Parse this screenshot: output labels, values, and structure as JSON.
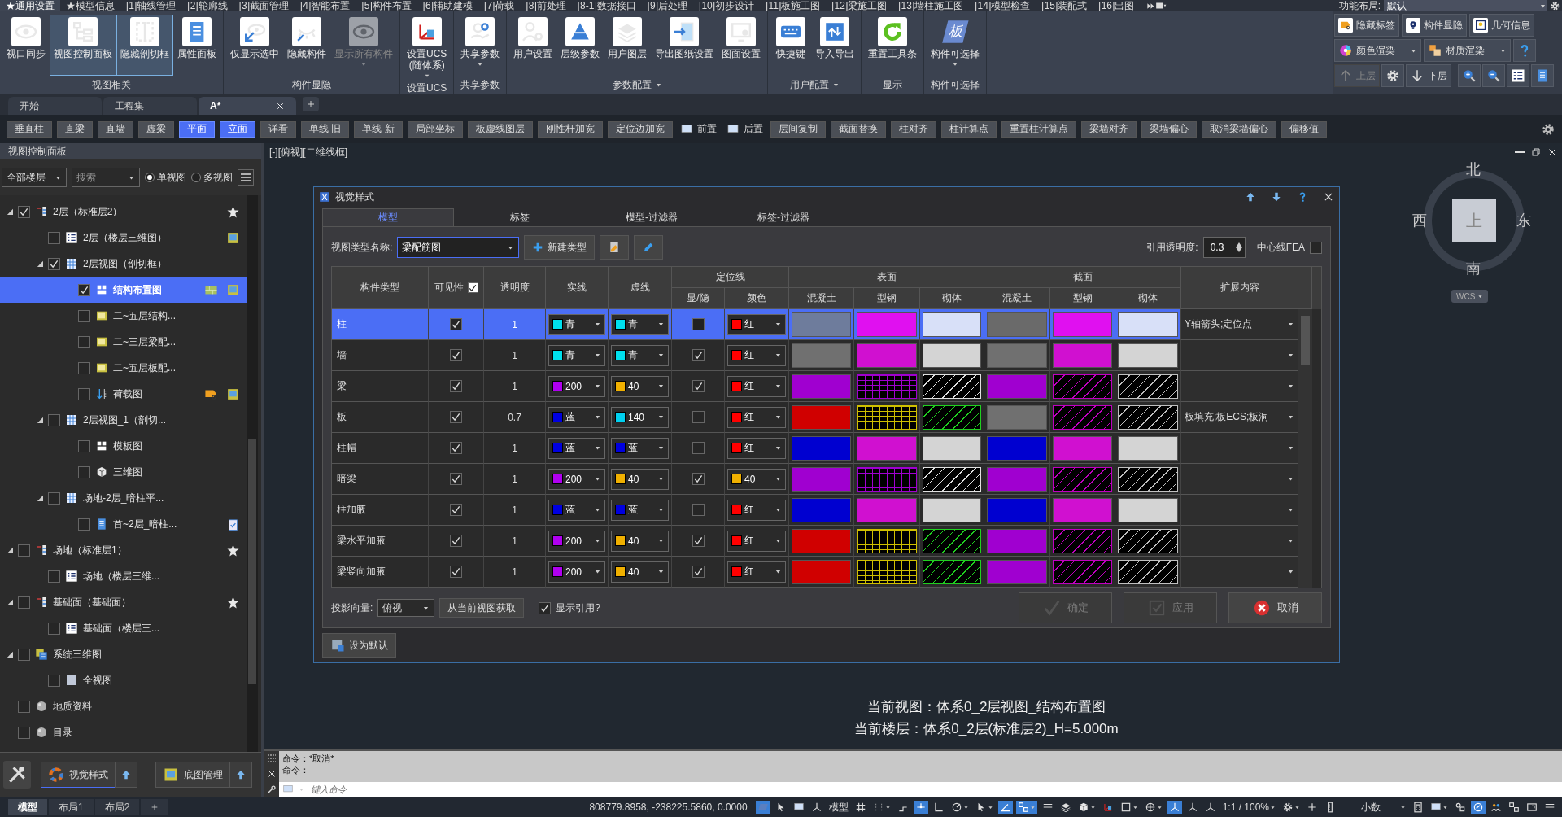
{
  "menu_tabs": [
    {
      "label": "★通用设置",
      "selected": true
    },
    {
      "label": "★模型信息",
      "selected": false
    },
    {
      "label": "[1]轴线管理",
      "selected": false
    },
    {
      "label": "[2]轮廓线",
      "selected": false
    },
    {
      "label": "[3]截面管理",
      "selected": false
    },
    {
      "label": "[4]智能布置",
      "selected": false
    },
    {
      "label": "[5]构件布置",
      "selected": false
    },
    {
      "label": "[6]辅助建模",
      "selected": false
    },
    {
      "label": "[7]荷载",
      "selected": false
    },
    {
      "label": "[8]前处理",
      "selected": false
    },
    {
      "label": "[8-1]数据接口",
      "selected": false
    },
    {
      "label": "[9]后处理",
      "selected": false
    },
    {
      "label": "[10]初步设计",
      "selected": false
    },
    {
      "label": "[11]板施工图",
      "selected": false
    },
    {
      "label": "[12]梁施工图",
      "selected": false
    },
    {
      "label": "[13]墙柱施工图",
      "selected": false
    },
    {
      "label": "[14]模型检查",
      "selected": false
    },
    {
      "label": "[15]装配式",
      "selected": false
    },
    {
      "label": "[16]出图",
      "selected": false
    }
  ],
  "layout_selector": {
    "label": "功能布局:",
    "value": "默认"
  },
  "ribbon": {
    "groups": [
      {
        "title": "视图相关",
        "menu": false,
        "buttons": [
          {
            "label": "视口同步",
            "selected": false,
            "disabled": false,
            "dropdown": false
          },
          {
            "label": "视图控制面板",
            "selected": true,
            "disabled": false,
            "dropdown": false
          },
          {
            "label": "隐藏剖切框",
            "selected": true,
            "disabled": false,
            "dropdown": false
          },
          {
            "label": "属性面板",
            "selected": false,
            "disabled": false,
            "dropdown": false
          }
        ]
      },
      {
        "title": "构件显隐",
        "menu": false,
        "buttons": [
          {
            "label": "仅显示选中",
            "selected": false,
            "disabled": false,
            "dropdown": false
          },
          {
            "label": "隐藏构件",
            "selected": false,
            "disabled": false,
            "dropdown": false
          },
          {
            "label": "显示所有构件",
            "selected": false,
            "disabled": true,
            "dropdown": true
          }
        ]
      },
      {
        "title": "设置UCS",
        "menu": false,
        "buttons": [
          {
            "label": "设置UCS\n(随体系)",
            "selected": false,
            "disabled": false,
            "dropdown": true
          }
        ]
      },
      {
        "title": "共享参数",
        "menu": false,
        "buttons": [
          {
            "label": "共享参数",
            "selected": false,
            "disabled": false,
            "dropdown": true
          }
        ]
      },
      {
        "title": "参数配置",
        "menu": true,
        "buttons": [
          {
            "label": "用户设置",
            "selected": false,
            "disabled": false,
            "dropdown": false
          },
          {
            "label": "层级参数",
            "selected": false,
            "disabled": false,
            "dropdown": false
          },
          {
            "label": "用户图层",
            "selected": false,
            "disabled": false,
            "dropdown": false
          },
          {
            "label": "导出图纸设置",
            "selected": false,
            "disabled": false,
            "dropdown": false
          },
          {
            "label": "图面设置",
            "selected": false,
            "disabled": false,
            "dropdown": false
          }
        ]
      },
      {
        "title": "用户配置",
        "menu": true,
        "buttons": [
          {
            "label": "快捷键",
            "selected": false,
            "disabled": false,
            "dropdown": false
          },
          {
            "label": "导入导出",
            "selected": false,
            "disabled": false,
            "dropdown": false
          }
        ]
      },
      {
        "title": "显示",
        "menu": false,
        "buttons": [
          {
            "label": "重置工具条",
            "selected": false,
            "disabled": false,
            "dropdown": false
          }
        ]
      },
      {
        "title": "构件可选择",
        "menu": false,
        "buttons": [
          {
            "label": "构件可选择",
            "icon_text": "板",
            "selected": false,
            "disabled": false,
            "dropdown": true
          }
        ]
      }
    ],
    "side_rows": [
      [
        {
          "label": "隐藏标签",
          "dropdown": false,
          "disabled": false
        },
        {
          "label": "构件显隐",
          "dropdown": false,
          "disabled": false
        },
        {
          "label": "几何信息",
          "dropdown": false,
          "disabled": false
        }
      ],
      [
        {
          "label": "颜色渲染",
          "dropdown": true,
          "disabled": false
        },
        {
          "label": "材质渲染",
          "dropdown": true,
          "disabled": false
        },
        {
          "dropdown": false,
          "disabled": false
        }
      ],
      [
        {
          "label": "上层",
          "dropdown": false,
          "disabled": true
        },
        {
          "dropdown": false,
          "disabled": false
        },
        {
          "label": "下层",
          "dropdown": false,
          "disabled": false
        },
        {
          "dropdown": false,
          "disabled": false
        },
        {
          "dropdown": false,
          "disabled": false
        },
        {
          "dropdown": false,
          "disabled": false
        },
        {
          "dropdown": false,
          "disabled": false
        }
      ]
    ]
  },
  "doc_tabs": [
    {
      "label": "开始",
      "selected": false,
      "closable": false
    },
    {
      "label": "工程集",
      "selected": false,
      "closable": false
    },
    {
      "label": "A*",
      "selected": true,
      "closable": true
    }
  ],
  "toolbar": [
    {
      "kind": "button",
      "label": "垂直柱",
      "selected": false
    },
    {
      "kind": "button",
      "label": "直梁",
      "selected": false
    },
    {
      "kind": "button",
      "label": "直墙",
      "selected": false
    },
    {
      "kind": "button",
      "label": "虚梁",
      "selected": false
    },
    {
      "kind": "button",
      "label": "平面",
      "selected": true
    },
    {
      "kind": "button",
      "label": "立面",
      "selected": true
    },
    {
      "kind": "button",
      "label": "详看",
      "selected": false
    },
    {
      "kind": "button",
      "label": "单线 旧",
      "selected": false
    },
    {
      "kind": "button",
      "label": "单线 新",
      "selected": false
    },
    {
      "kind": "button",
      "label": "局部坐标",
      "selected": false
    },
    {
      "kind": "button",
      "label": "板虚线图层",
      "selected": false
    },
    {
      "kind": "button",
      "label": "刚性杆加宽",
      "selected": false
    },
    {
      "kind": "button",
      "label": "定位边加宽",
      "selected": false
    },
    {
      "kind": "icon",
      "label": "前置",
      "selected": false
    },
    {
      "kind": "icon",
      "label": "后置",
      "selected": false
    },
    {
      "kind": "button",
      "label": "层间复制",
      "selected": false
    },
    {
      "kind": "button",
      "label": "截面替换",
      "selected": false
    },
    {
      "kind": "button",
      "label": "柱对齐",
      "selected": false
    },
    {
      "kind": "button",
      "label": "柱计算点",
      "selected": false
    },
    {
      "kind": "button",
      "label": "重置柱计算点",
      "selected": false
    },
    {
      "kind": "button",
      "label": "梁墙对齐",
      "selected": false
    },
    {
      "kind": "button",
      "label": "梁墙偏心",
      "selected": false
    },
    {
      "kind": "button",
      "label": "取消梁墙偏心",
      "selected": false
    },
    {
      "kind": "button",
      "label": "偏移值",
      "selected": false
    }
  ],
  "panel": {
    "title": "视图控制面板",
    "floor_filter": "全部楼层",
    "search_placeholder": "搜索",
    "view_modes": [
      {
        "label": "单视图",
        "selected": true
      },
      {
        "label": "多视图",
        "selected": false
      }
    ],
    "tree": [
      {
        "label": "2层（标准层2）",
        "checked": true,
        "selected": false,
        "expanded": true,
        "children": [
          {
            "label": "2层（楼层三维图）",
            "checked": false,
            "selected": false
          },
          {
            "label": "2层视图（剖切框）",
            "checked": true,
            "selected": false,
            "expanded": true,
            "children": [
              {
                "label": "结构布置图",
                "checked": true,
                "selected": true
              },
              {
                "label": "二~五层结构...",
                "checked": false,
                "selected": false
              },
              {
                "label": "二~三层梁配...",
                "checked": false,
                "selected": false
              },
              {
                "label": "二~五层板配...",
                "checked": false,
                "selected": false
              },
              {
                "label": "荷载图",
                "checked": false,
                "selected": false
              }
            ]
          },
          {
            "label": "2层视图_1（剖切...",
            "checked": false,
            "selected": false,
            "expanded": true,
            "children": [
              {
                "label": "模板图",
                "checked": false,
                "selected": false
              },
              {
                "label": "三维图",
                "checked": false,
                "selected": false
              }
            ]
          },
          {
            "label": "场地-2层_暗柱平...",
            "checked": false,
            "selected": false,
            "expanded": true,
            "children": [
              {
                "label": "首~2层_暗柱...",
                "checked": false,
                "selected": false
              }
            ]
          }
        ]
      },
      {
        "label": "场地（标准层1）",
        "checked": false,
        "selected": false,
        "expanded": true,
        "children": [
          {
            "label": "场地（楼层三维...",
            "checked": false,
            "selected": false
          }
        ]
      },
      {
        "label": "基础面（基础面）",
        "checked": false,
        "selected": false,
        "expanded": true,
        "children": [
          {
            "label": "基础面（楼层三...",
            "checked": false,
            "selected": false
          }
        ]
      },
      {
        "label": "系统三维图",
        "checked": false,
        "selected": false,
        "expanded": true,
        "children": [
          {
            "label": "全视图",
            "checked": false,
            "selected": false
          }
        ]
      },
      {
        "label": "地质资料",
        "checked": false,
        "selected": false
      },
      {
        "label": "目录",
        "checked": false,
        "selected": false
      }
    ],
    "bottom_buttons": [
      {
        "label": "视觉样式",
        "selected": true
      },
      {
        "label": "底图管理",
        "selected": false
      }
    ]
  },
  "layout_tabs": [
    {
      "label": "模型",
      "selected": true
    },
    {
      "label": "布局1",
      "selected": false
    },
    {
      "label": "布局2",
      "selected": false
    }
  ],
  "viewport_label": "[-][俯视][二维线框]",
  "compass": {
    "north": "北",
    "south": "南",
    "east": "东",
    "west": "西",
    "center": "上",
    "ucs": "WCS"
  },
  "dialog": {
    "title": "视觉样式",
    "tabs": [
      {
        "label": "模型",
        "selected": true
      },
      {
        "label": "标签",
        "selected": false
      },
      {
        "label": "模型-过滤器",
        "selected": false
      },
      {
        "label": "标签-过滤器",
        "selected": false
      }
    ],
    "type_label": "视图类型名称:",
    "type_value": "梁配筋图",
    "new_type": "新建类型",
    "opacity_label": "引用透明度:",
    "opacity_value": "0.3",
    "fea_label": "中心线FEA",
    "fea_checked": false,
    "headers": {
      "type": "构件类型",
      "visible": "可见性",
      "visible_all": true,
      "transparency": "透明度",
      "solid": "实线",
      "dashed": "虚线",
      "locline": "定位线",
      "loc_show": "显/隐",
      "loc_color": "颜色",
      "surface": "表面",
      "surface_cols": [
        "混凝土",
        "型钢",
        "砌体"
      ],
      "section": "截面",
      "section_cols": [
        "混凝土",
        "型钢",
        "砌体"
      ],
      "ext": "扩展内容"
    },
    "rows": [
      {
        "name": "柱",
        "selected": true,
        "visible": true,
        "transparency": "1",
        "solid": {
          "label": "青",
          "color": "#00e0ee"
        },
        "dashed": {
          "label": "青",
          "color": "#00e0ee"
        },
        "loc_shown": false,
        "loc_color": {
          "label": "红",
          "color": "#ff0000"
        },
        "surface": [
          {
            "kind": "solid",
            "color": "#6e7c9c"
          },
          {
            "kind": "solid",
            "color": "#e010f0"
          },
          {
            "kind": "solid",
            "color": "#d8e0f8"
          }
        ],
        "section": [
          {
            "kind": "solid",
            "color": "#6a6a6a"
          },
          {
            "kind": "solid",
            "color": "#e010f0"
          },
          {
            "kind": "solid",
            "color": "#d8e0f8"
          }
        ],
        "ext": "Y轴箭头;定位点"
      },
      {
        "name": "墙",
        "selected": false,
        "visible": true,
        "transparency": "1",
        "solid": {
          "label": "青",
          "color": "#00e0ee"
        },
        "dashed": {
          "label": "青",
          "color": "#00e0ee"
        },
        "loc_shown": true,
        "loc_color": {
          "label": "红",
          "color": "#ff0000"
        },
        "surface": [
          {
            "kind": "solid",
            "color": "#707070"
          },
          {
            "kind": "solid",
            "color": "#d010d0"
          },
          {
            "kind": "solid",
            "color": "#d4d4d4"
          }
        ],
        "section": [
          {
            "kind": "solid",
            "color": "#707070"
          },
          {
            "kind": "solid",
            "color": "#d010d0"
          },
          {
            "kind": "solid",
            "color": "#d4d4d4"
          }
        ]
      },
      {
        "name": "梁",
        "selected": false,
        "visible": true,
        "transparency": "1",
        "solid": {
          "label": "200",
          "color": "#b000f0"
        },
        "dashed": {
          "label": "40",
          "color": "#f0b000"
        },
        "loc_shown": true,
        "loc_color": {
          "label": "红",
          "color": "#ff0000"
        },
        "surface": [
          {
            "kind": "solid",
            "color": "#a000d0"
          },
          {
            "kind": "grid",
            "color": "#a000d0"
          },
          {
            "kind": "hatch",
            "color": "#e0e0e0"
          }
        ],
        "section": [
          {
            "kind": "solid",
            "color": "#a000d0"
          },
          {
            "kind": "hatch",
            "color": "#c000c0"
          },
          {
            "kind": "hatch",
            "color": "#c0c0c0"
          }
        ]
      },
      {
        "name": "板",
        "selected": false,
        "visible": true,
        "transparency": "0.7",
        "solid": {
          "label": "蓝",
          "color": "#0000e0"
        },
        "dashed": {
          "label": "140",
          "color": "#00d0f0"
        },
        "loc_shown": false,
        "loc_color": {
          "label": "红",
          "color": "#ff0000"
        },
        "surface": [
          {
            "kind": "solid",
            "color": "#d00000"
          },
          {
            "kind": "grid",
            "color": "#d0c000"
          },
          {
            "kind": "hatch",
            "color": "#20d020"
          }
        ],
        "section": [
          {
            "kind": "solid",
            "color": "#707070"
          },
          {
            "kind": "hatch",
            "color": "#c000c0"
          },
          {
            "kind": "hatch",
            "color": "#c0c0c0"
          }
        ],
        "ext": "板填充;板ECS;板洞"
      },
      {
        "name": "柱帽",
        "selected": false,
        "visible": true,
        "transparency": "1",
        "solid": {
          "label": "蓝",
          "color": "#0000e0"
        },
        "dashed": {
          "label": "蓝",
          "color": "#0000e0"
        },
        "loc_shown": false,
        "loc_color": {
          "label": "红",
          "color": "#ff0000"
        },
        "surface": [
          {
            "kind": "solid",
            "color": "#0000d0"
          },
          {
            "kind": "solid",
            "color": "#d010d0"
          },
          {
            "kind": "solid",
            "color": "#d4d4d4"
          }
        ],
        "section": [
          {
            "kind": "solid",
            "color": "#0000d0"
          },
          {
            "kind": "solid",
            "color": "#d010d0"
          },
          {
            "kind": "solid",
            "color": "#d4d4d4"
          }
        ]
      },
      {
        "name": "暗梁",
        "selected": false,
        "visible": true,
        "transparency": "1",
        "solid": {
          "label": "200",
          "color": "#b000f0"
        },
        "dashed": {
          "label": "40",
          "color": "#f0b000"
        },
        "loc_shown": true,
        "loc_color": {
          "label": "40",
          "color": "#f0b000"
        },
        "surface": [
          {
            "kind": "solid",
            "color": "#a000d0"
          },
          {
            "kind": "grid",
            "color": "#a000d0"
          },
          {
            "kind": "hatch",
            "color": "#e0e0e0"
          }
        ],
        "section": [
          {
            "kind": "solid",
            "color": "#a000d0"
          },
          {
            "kind": "hatch",
            "color": "#c000c0"
          },
          {
            "kind": "hatch",
            "color": "#c0c0c0"
          }
        ]
      },
      {
        "name": "柱加腋",
        "selected": false,
        "visible": true,
        "transparency": "1",
        "solid": {
          "label": "蓝",
          "color": "#0000e0"
        },
        "dashed": {
          "label": "蓝",
          "color": "#0000e0"
        },
        "loc_shown": false,
        "loc_color": {
          "label": "红",
          "color": "#ff0000"
        },
        "surface": [
          {
            "kind": "solid",
            "color": "#0000d0"
          },
          {
            "kind": "solid",
            "color": "#d010d0"
          },
          {
            "kind": "solid",
            "color": "#d4d4d4"
          }
        ],
        "section": [
          {
            "kind": "solid",
            "color": "#0000d0"
          },
          {
            "kind": "solid",
            "color": "#d010d0"
          },
          {
            "kind": "solid",
            "color": "#d4d4d4"
          }
        ]
      },
      {
        "name": "梁水平加腋",
        "selected": false,
        "visible": true,
        "transparency": "1",
        "solid": {
          "label": "200",
          "color": "#b000f0"
        },
        "dashed": {
          "label": "40",
          "color": "#f0b000"
        },
        "loc_shown": true,
        "loc_color": {
          "label": "红",
          "color": "#ff0000"
        },
        "surface": [
          {
            "kind": "solid",
            "color": "#d00000"
          },
          {
            "kind": "grid",
            "color": "#d0c000"
          },
          {
            "kind": "hatch",
            "color": "#20d020"
          }
        ],
        "section": [
          {
            "kind": "solid",
            "color": "#a000d0"
          },
          {
            "kind": "hatch",
            "color": "#c000c0"
          },
          {
            "kind": "hatch",
            "color": "#c0c0c0"
          }
        ]
      },
      {
        "name": "梁竖向加腋",
        "selected": false,
        "visible": true,
        "transparency": "1",
        "solid": {
          "label": "200",
          "color": "#b000f0"
        },
        "dashed": {
          "label": "40",
          "color": "#f0b000"
        },
        "loc_shown": true,
        "loc_color": {
          "label": "红",
          "color": "#ff0000"
        },
        "surface": [
          {
            "kind": "solid",
            "color": "#d00000"
          },
          {
            "kind": "grid",
            "color": "#d0c000"
          },
          {
            "kind": "hatch",
            "color": "#20d020"
          }
        ],
        "section": [
          {
            "kind": "solid",
            "color": "#a000d0"
          },
          {
            "kind": "hatch",
            "color": "#c000c0"
          },
          {
            "kind": "hatch",
            "color": "#c0c0c0"
          }
        ]
      }
    ],
    "projection_label": "投影向量:",
    "projection_value": "俯视",
    "fetch_button": "从当前视图获取",
    "show_ref_label": "显示引用?",
    "show_ref_checked": true,
    "actions": [
      {
        "label": "确定",
        "disabled": true
      },
      {
        "label": "应用",
        "disabled": true
      },
      {
        "label": "取消",
        "disabled": false
      }
    ],
    "default_button": "设为默认"
  },
  "status_lines": [
    "当前视图：体系0_2层视图_结构布置图",
    "当前楼层：体系0_2层(标准层2)_H=5.000m"
  ],
  "command": {
    "history": [
      "命令：*取消*",
      "命令："
    ],
    "placeholder": "键入命令"
  },
  "status_bar": {
    "coordinates": "808779.8958, -238225.5860, 0.0000",
    "items": [
      {
        "kind": "icon",
        "active": true,
        "dropdown": false
      },
      {
        "kind": "icon",
        "active": false,
        "dropdown": false
      },
      {
        "kind": "icon",
        "active": false,
        "dropdown": false
      },
      {
        "kind": "icon",
        "active": false,
        "dropdown": false
      },
      {
        "kind": "text",
        "label": "模型",
        "active": false,
        "dropdown": false
      },
      {
        "kind": "icon",
        "active": false,
        "dropdown": false
      },
      {
        "kind": "icon",
        "active": false,
        "dropdown": true
      },
      {
        "kind": "icon",
        "active": false,
        "dropdown": false
      },
      {
        "kind": "icon",
        "active": true,
        "dropdown": false
      },
      {
        "kind": "icon",
        "active": false,
        "dropdown": false
      },
      {
        "kind": "icon",
        "active": false,
        "dropdown": true
      },
      {
        "kind": "icon",
        "active": false,
        "dropdown": true
      },
      {
        "kind": "icon",
        "active": true,
        "dropdown": false
      },
      {
        "kind": "icon",
        "active": true,
        "dropdown": true
      },
      {
        "kind": "icon",
        "active": false,
        "dropdown": false
      },
      {
        "kind": "icon",
        "active": false,
        "dropdown": false
      },
      {
        "kind": "icon",
        "active": false,
        "dropdown": true
      },
      {
        "kind": "icon",
        "active": false,
        "dropdown": false
      },
      {
        "kind": "icon",
        "active": false,
        "dropdown": true
      },
      {
        "kind": "icon",
        "active": false,
        "dropdown": true
      },
      {
        "kind": "icon",
        "active": true,
        "dropdown": false
      },
      {
        "kind": "icon",
        "active": false,
        "dropdown": false
      },
      {
        "kind": "icon",
        "active": false,
        "dropdown": false
      },
      {
        "kind": "text",
        "label": "1:1 / 100%",
        "active": false,
        "dropdown": true
      },
      {
        "kind": "icon",
        "active": false,
        "dropdown": true
      },
      {
        "kind": "icon",
        "active": false,
        "dropdown": false
      },
      {
        "kind": "icon",
        "active": false,
        "dropdown": false
      },
      {
        "kind": "select",
        "label": "小数",
        "active": false,
        "dropdown": true
      },
      {
        "kind": "icon",
        "active": false,
        "dropdown": false
      },
      {
        "kind": "icon",
        "active": false,
        "dropdown": true
      },
      {
        "kind": "icon",
        "active": false,
        "dropdown": false
      },
      {
        "kind": "icon",
        "active": true,
        "dropdown": false
      },
      {
        "kind": "icon",
        "active": false,
        "dropdown": false
      },
      {
        "kind": "icon",
        "active": false,
        "dropdown": false
      },
      {
        "kind": "icon",
        "active": false,
        "dropdown": false
      },
      {
        "kind": "icon",
        "active": false,
        "dropdown": false
      }
    ]
  }
}
